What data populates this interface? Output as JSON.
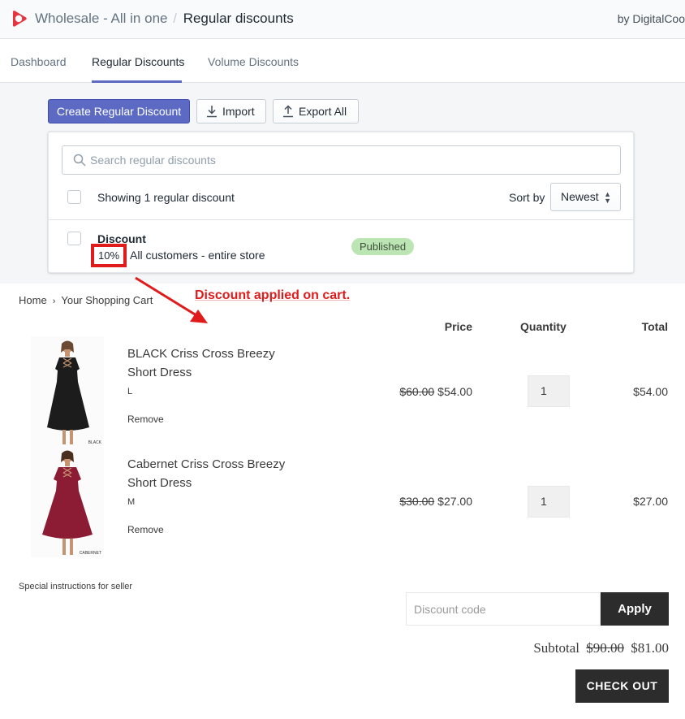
{
  "header": {
    "app_name": "Wholesale - All in one",
    "separator": "/",
    "current_page": "Regular discounts",
    "byline": "by DigitalCoo"
  },
  "tabs": [
    {
      "label": "Dashboard",
      "active": false
    },
    {
      "label": "Regular Discounts",
      "active": true
    },
    {
      "label": "Volume Discounts",
      "active": false
    }
  ],
  "actions": {
    "create_label": "Create Regular Discount",
    "import_label": "Import",
    "export_label": "Export All"
  },
  "list": {
    "search_placeholder": "Search regular discounts",
    "showing_text": "Showing 1 regular discount",
    "sort_label": "Sort by",
    "sort_value": "Newest",
    "items": [
      {
        "title": "Discount",
        "percent": "10%",
        "description": "All customers - entire store",
        "status": "Published"
      }
    ]
  },
  "annotation": {
    "text": "Discount applied on cart.",
    "color": "#e01b1b"
  },
  "cart": {
    "breadcrumb": [
      "Home",
      "Your Shopping Cart"
    ],
    "breadcrumb_separator": "›",
    "columns": {
      "price": "Price",
      "quantity": "Quantity",
      "total": "Total"
    },
    "items": [
      {
        "name": "BLACK Criss Cross Breezy Short Dress",
        "variant": "L",
        "remove_label": "Remove",
        "original_price": "$60.00",
        "price": "$54.00",
        "quantity": "1",
        "total": "$54.00",
        "image_tag": "BLACK",
        "dress_color": "#1c1c1c"
      },
      {
        "name": "Cabernet Criss Cross Breezy Short Dress",
        "variant": "M",
        "remove_label": "Remove",
        "original_price": "$30.00",
        "price": "$27.00",
        "quantity": "1",
        "total": "$27.00",
        "image_tag": "CABERNET",
        "dress_color": "#8c1c34"
      }
    ],
    "instructions_label": "Special instructions for seller",
    "discount_placeholder": "Discount code",
    "apply_label": "Apply",
    "subtotal_label": "Subtotal",
    "subtotal_original": "$90.00",
    "subtotal_value": "$81.00",
    "checkout_label": "CHECK OUT"
  },
  "colors": {
    "primary": "#5c6ac4",
    "badge_bg": "#bbe5b3",
    "store_button": "#2c2c2c",
    "highlight": "#e01b1b"
  }
}
